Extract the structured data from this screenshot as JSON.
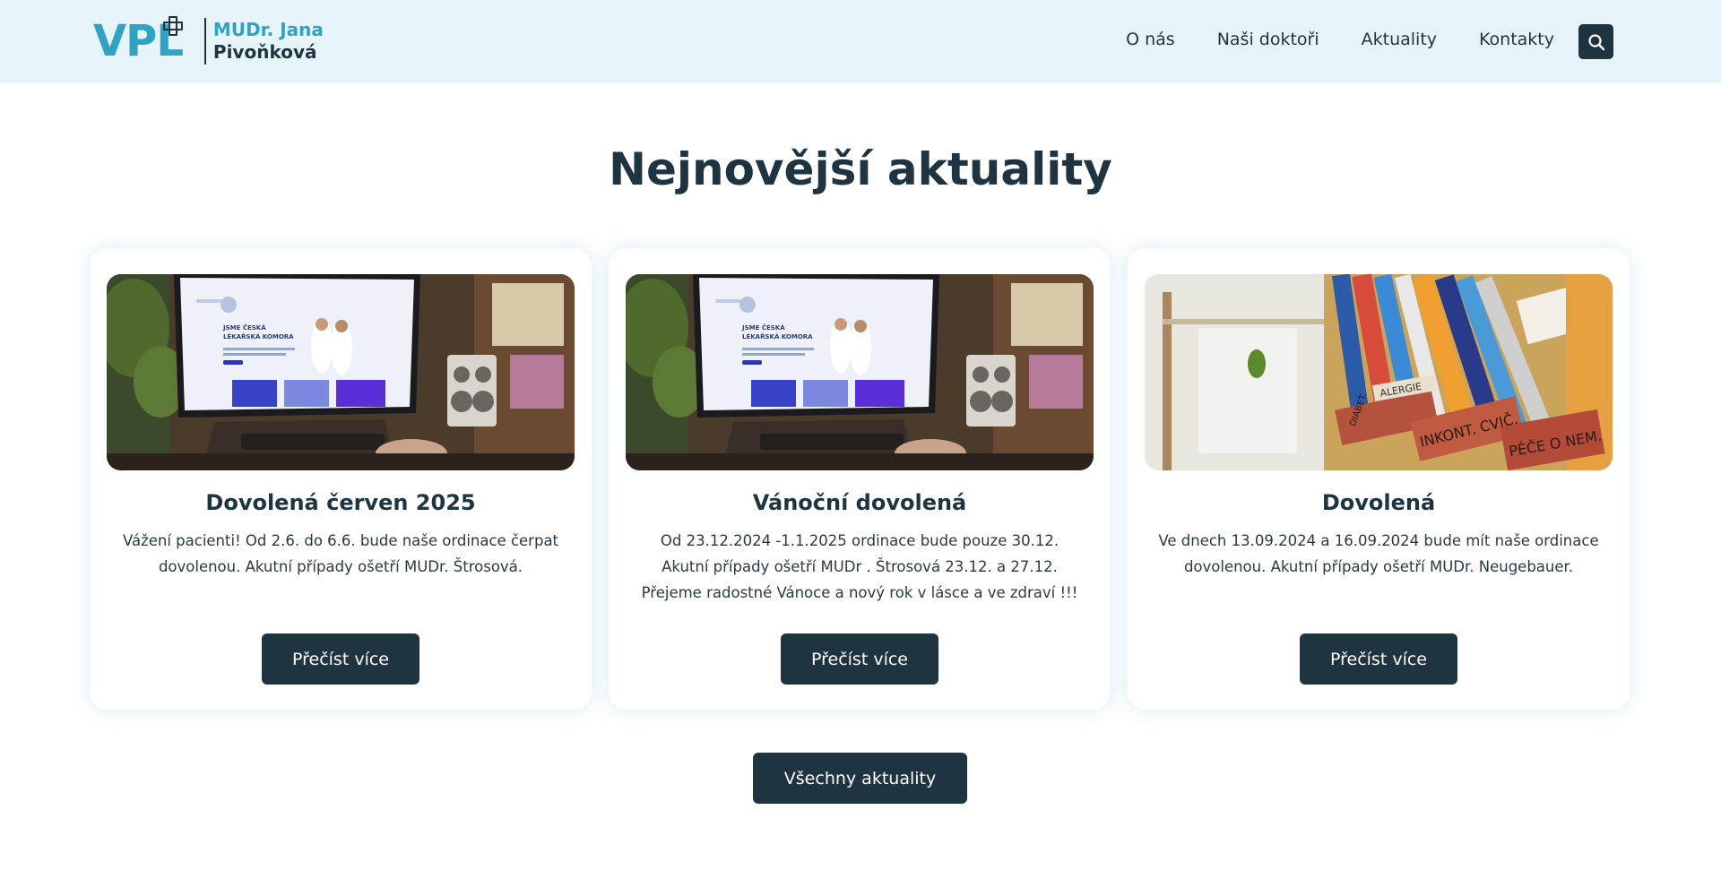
{
  "header": {
    "logo_mark": "VPL",
    "logo_line1": "MUDr. Jana",
    "logo_line2": "Pivoňková",
    "nav": [
      {
        "label": "O nás"
      },
      {
        "label": "Naši doktoři"
      },
      {
        "label": "Aktuality"
      },
      {
        "label": "Kontakty"
      }
    ],
    "search_icon": "search-icon"
  },
  "main": {
    "title": "Nejnovější aktuality",
    "cards": [
      {
        "title": "Dovolená červen 2025",
        "text": "Vážení pacienti! Od 2.6. do 6.6. bude naše ordinace čerpat dovolenou. Akutní případy ošetří MUDr. Štrosová.",
        "button": "Přečíst více",
        "image_screen_line1": "JSME ČESKÁ",
        "image_screen_line2": "LÉKAŘSKÁ KOMORA"
      },
      {
        "title": "Vánoční dovolená",
        "text": "Od 23.12.2024 -1.1.2025 ordinace bude pouze 30.12. Akutní případy ošetří MUDr . Štrosová 23.12. a 27.12. Přejeme radostné Vánoce a nový rok v lásce a ve zdraví !!!",
        "button": "Přečíst více",
        "image_screen_line1": "JSME ČESKÁ",
        "image_screen_line2": "LÉKAŘSKÁ KOMORA"
      },
      {
        "title": "Dovolená",
        "text": "Ve dnech 13.09.2024 a 16.09.2024 bude mít naše ordinace dovolenou. Akutní případy ošetří MUDr. Neugebauer.",
        "button": "Přečíst více",
        "image_tag1": "ALERGIE",
        "image_tag2": "INKONT. CVIČ.",
        "image_tag3": "PÉČE O NEM.",
        "image_tag4": "DIABET."
      }
    ],
    "all_button": "Všechny aktuality"
  },
  "colors": {
    "accent": "#2fa3c4",
    "dark": "#1e3440",
    "header_bg": "#e6f4f7"
  }
}
